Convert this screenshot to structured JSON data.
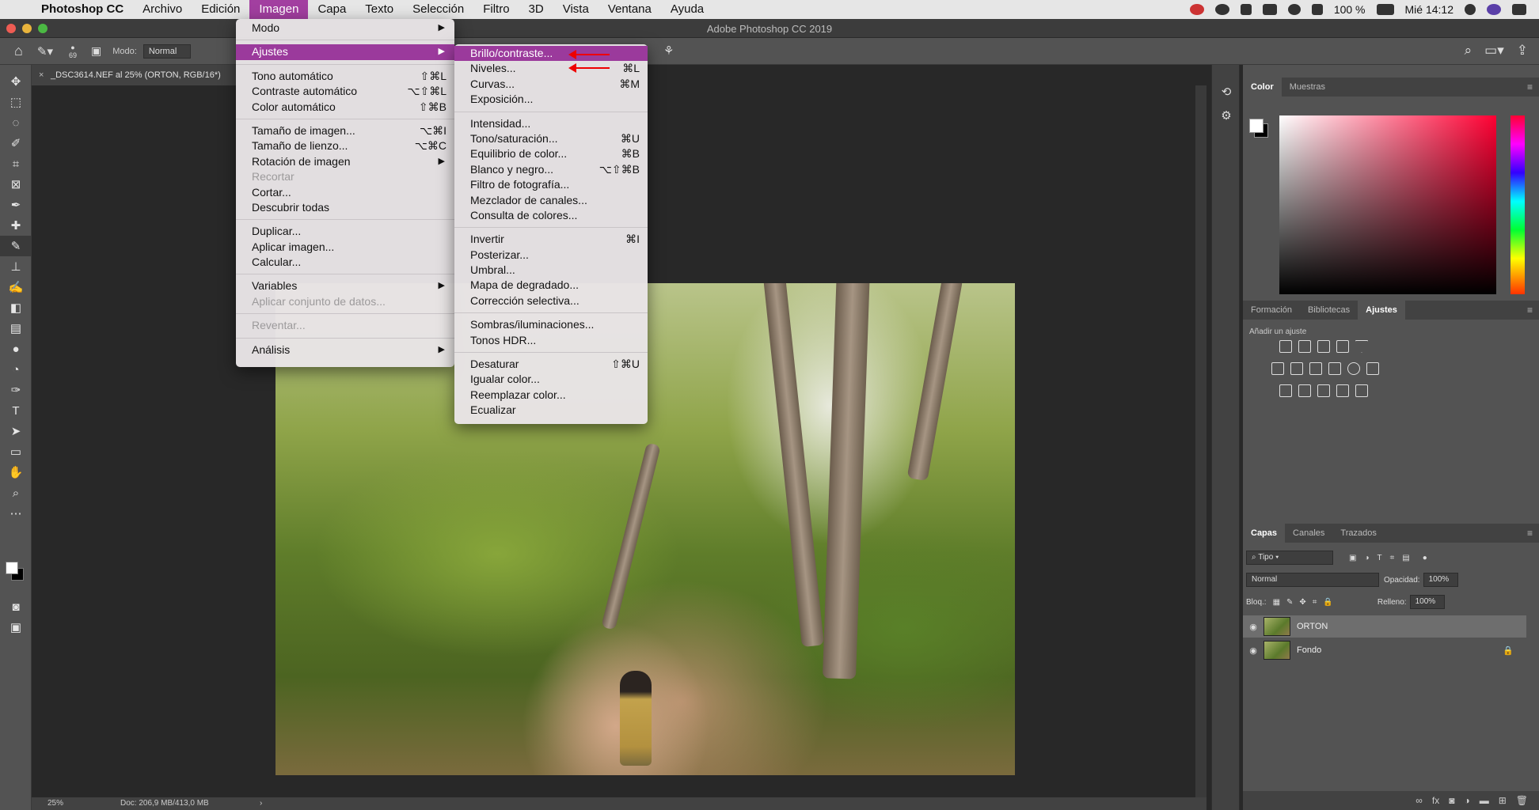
{
  "menubar": {
    "app": "Photoshop CC",
    "items": [
      "Archivo",
      "Edición",
      "Imagen",
      "Capa",
      "Texto",
      "Selección",
      "Filtro",
      "3D",
      "Vista",
      "Ventana",
      "Ayuda"
    ],
    "active": "Imagen",
    "battery": "100 %",
    "clock": "Mié 14:12"
  },
  "window": {
    "title": "Adobe Photoshop CC 2019"
  },
  "options": {
    "brush_size": "69",
    "modo_label": "Modo:",
    "modo_value": "Normal"
  },
  "document": {
    "tab": "_DSC3614.NEF al 25% (ORTON, RGB/16*)"
  },
  "status": {
    "zoom": "25%",
    "doc": "Doc: 206,9 MB/413,0 MB"
  },
  "imagen_menu": [
    {
      "label": "Modo",
      "sub": true
    },
    {
      "sep": true
    },
    {
      "label": "Ajustes",
      "sub": true,
      "hl": true
    },
    {
      "sep": true
    },
    {
      "label": "Tono automático",
      "sc": "⇧⌘L"
    },
    {
      "label": "Contraste automático",
      "sc": "⌥⇧⌘L"
    },
    {
      "label": "Color automático",
      "sc": "⇧⌘B"
    },
    {
      "sep": true
    },
    {
      "label": "Tamaño de imagen...",
      "sc": "⌥⌘I"
    },
    {
      "label": "Tamaño de lienzo...",
      "sc": "⌥⌘C"
    },
    {
      "label": "Rotación de imagen",
      "sub": true
    },
    {
      "label": "Recortar",
      "dis": true
    },
    {
      "label": "Cortar..."
    },
    {
      "label": "Descubrir todas"
    },
    {
      "sep": true
    },
    {
      "label": "Duplicar..."
    },
    {
      "label": "Aplicar imagen..."
    },
    {
      "label": "Calcular..."
    },
    {
      "sep": true
    },
    {
      "label": "Variables",
      "sub": true
    },
    {
      "label": "Aplicar conjunto de datos...",
      "dis": true
    },
    {
      "sep": true
    },
    {
      "label": "Reventar...",
      "dis": true
    },
    {
      "sep": true
    },
    {
      "label": "Análisis",
      "sub": true
    }
  ],
  "ajustes_menu": [
    {
      "label": "Brillo/contraste...",
      "hl": true
    },
    {
      "label": "Niveles...",
      "sc": "⌘L"
    },
    {
      "label": "Curvas...",
      "sc": "⌘M"
    },
    {
      "label": "Exposición..."
    },
    {
      "sep": true
    },
    {
      "label": "Intensidad..."
    },
    {
      "label": "Tono/saturación...",
      "sc": "⌘U"
    },
    {
      "label": "Equilibrio de color...",
      "sc": "⌘B"
    },
    {
      "label": "Blanco y negro...",
      "sc": "⌥⇧⌘B"
    },
    {
      "label": "Filtro de fotografía..."
    },
    {
      "label": "Mezclador de canales..."
    },
    {
      "label": "Consulta de colores..."
    },
    {
      "sep": true
    },
    {
      "label": "Invertir",
      "sc": "⌘I"
    },
    {
      "label": "Posterizar..."
    },
    {
      "label": "Umbral..."
    },
    {
      "label": "Mapa de degradado..."
    },
    {
      "label": "Corrección selectiva..."
    },
    {
      "sep": true
    },
    {
      "label": "Sombras/iluminaciones..."
    },
    {
      "label": "Tonos HDR..."
    },
    {
      "sep": true
    },
    {
      "label": "Desaturar",
      "sc": "⇧⌘U"
    },
    {
      "label": "Igualar color..."
    },
    {
      "label": "Reemplazar color..."
    },
    {
      "label": "Ecualizar"
    }
  ],
  "panels": {
    "color_tabs": [
      "Color",
      "Muestras"
    ],
    "adj_tabs": [
      "Formación",
      "Bibliotecas",
      "Ajustes"
    ],
    "adj_title": "Añadir un ajuste",
    "layer_tabs": [
      "Capas",
      "Canales",
      "Trazados"
    ],
    "filter": "Tipo",
    "blend": "Normal",
    "opacity_label": "Opacidad:",
    "opacity": "100%",
    "lock_label": "Bloq.:",
    "fill_label": "Relleno:",
    "fill": "100%",
    "layers": [
      {
        "name": "ORTON",
        "selected": true
      },
      {
        "name": "Fondo",
        "locked": true
      }
    ]
  }
}
